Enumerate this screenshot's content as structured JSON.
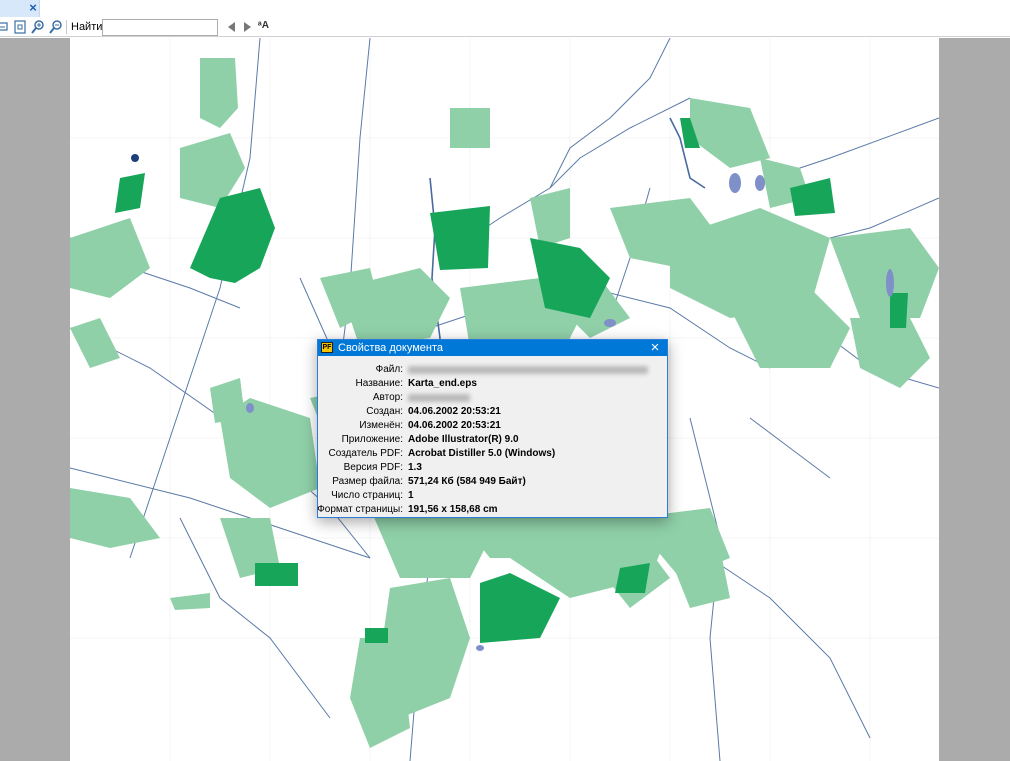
{
  "toolbar": {
    "find_label": "Найти:",
    "find_value": "",
    "match_case_label": "ᵃA"
  },
  "dialog": {
    "title": "Свойства документа",
    "icon_text": "PF",
    "colors": {
      "titlebar": "#0078d7",
      "map_light": "#8fd0a8",
      "map_dark": "#17a55a",
      "water": "#7f8fc8",
      "road": "#5a7aa8"
    },
    "rows": [
      {
        "label": "Файл:",
        "value": "",
        "redacted": true
      },
      {
        "label": "Название:",
        "value": "Karta_end.eps"
      },
      {
        "label": "Автор:",
        "value": "",
        "redacted": true
      },
      {
        "label": "Создан:",
        "value": "04.06.2002 20:53:21"
      },
      {
        "label": "Изменён:",
        "value": "04.06.2002 20:53:21"
      },
      {
        "label": "Приложение:",
        "value": "Adobe Illustrator(R) 9.0"
      },
      {
        "label": "Создатель PDF:",
        "value": "Acrobat Distiller 5.0 (Windows)"
      },
      {
        "label": "Версия PDF:",
        "value": "1.3"
      },
      {
        "label": "Размер файла:",
        "value": "571,24 Кб (584 949 Байт)"
      },
      {
        "label": "Число страниц:",
        "value": "1"
      },
      {
        "label": "Формат страницы:",
        "value": "191,56 x 158,68 cm"
      }
    ]
  }
}
